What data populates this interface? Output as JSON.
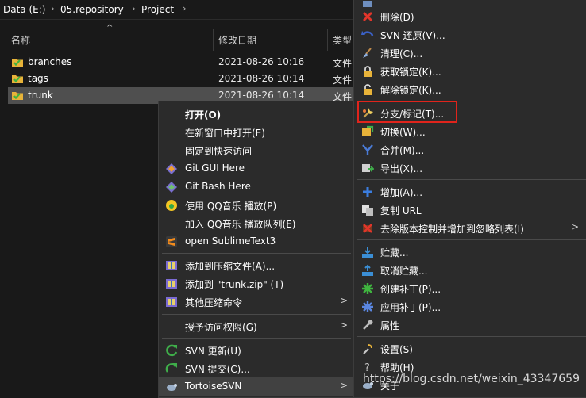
{
  "breadcrumb": {
    "items": [
      "Data (E:)",
      "05.repository",
      "Project"
    ],
    "separator": "›"
  },
  "columns": {
    "name": "名称",
    "date": "修改日期",
    "type": "类型"
  },
  "files": [
    {
      "name": "branches",
      "date": "2021-08-26 10:16",
      "type": "文件",
      "icon": "svn-folder-icon"
    },
    {
      "name": "tags",
      "date": "2021-08-26 10:14",
      "type": "文件",
      "icon": "svn-folder-icon"
    },
    {
      "name": "trunk",
      "date": "2021-08-26 10:14",
      "type": "文件",
      "icon": "svn-folder-icon",
      "selected": true
    }
  ],
  "context_menu": {
    "items": [
      {
        "label": "打开(O)",
        "bold": true
      },
      {
        "label": "在新窗口中打开(E)"
      },
      {
        "label": "固定到快速访问"
      },
      {
        "label": "Git GUI Here",
        "icon": "git-gui-icon"
      },
      {
        "label": "Git Bash Here",
        "icon": "git-bash-icon"
      },
      {
        "label": "使用 QQ音乐 播放(P)",
        "icon": "qq-music-icon"
      },
      {
        "label": "加入 QQ音乐 播放队列(E)"
      },
      {
        "label": "open SublimeText3",
        "icon": "sublime-icon"
      },
      {
        "label": "添加到压缩文件(A)...",
        "icon": "archive-icon"
      },
      {
        "label": "添加到 \"trunk.zip\" (T)",
        "icon": "archive-icon"
      },
      {
        "label": "其他压缩命令",
        "icon": "archive-icon",
        "submenu": true
      },
      {
        "label": "授予访问权限(G)",
        "submenu": true
      },
      {
        "label": "SVN 更新(U)",
        "icon": "svn-update-icon"
      },
      {
        "label": "SVN 提交(C)...",
        "icon": "svn-commit-icon"
      },
      {
        "label": "TortoiseSVN",
        "icon": "tortoisesvn-icon",
        "submenu": true,
        "highlighted": true
      }
    ]
  },
  "svn_menu": {
    "items": [
      {
        "label": "",
        "icon": "partial-icon"
      },
      {
        "label": "删除(D)",
        "icon": "delete-icon"
      },
      {
        "label": "SVN 还原(V)...",
        "icon": "revert-icon"
      },
      {
        "label": "清理(C)...",
        "icon": "cleanup-icon"
      },
      {
        "label": "获取锁定(K)...",
        "icon": "lock-icon"
      },
      {
        "label": "解除锁定(K)...",
        "icon": "unlock-icon"
      },
      {
        "label": "分支/标记(T)...",
        "icon": "branch-tag-icon"
      },
      {
        "label": "切换(W)...",
        "icon": "switch-icon"
      },
      {
        "label": "合并(M)...",
        "icon": "merge-icon"
      },
      {
        "label": "导出(X)...",
        "icon": "export-icon"
      },
      {
        "label": "增加(A)...",
        "icon": "add-icon"
      },
      {
        "label": "复制 URL",
        "icon": "copy-url-icon"
      },
      {
        "label": "去除版本控制并增加到忽略列表(I)",
        "icon": "ignore-icon",
        "submenu": true
      },
      {
        "label": "贮藏...",
        "icon": "shelve-icon"
      },
      {
        "label": "取消贮藏...",
        "icon": "unshelve-icon"
      },
      {
        "label": "创建补丁(P)...",
        "icon": "create-patch-icon"
      },
      {
        "label": "应用补丁(P)...",
        "icon": "apply-patch-icon"
      },
      {
        "label": "属性",
        "icon": "properties-icon"
      },
      {
        "label": "设置(S)",
        "icon": "settings-icon"
      },
      {
        "label": "帮助(H)",
        "icon": "help-icon"
      },
      {
        "label": "关于",
        "icon": "about-icon"
      }
    ]
  },
  "watermark": "https://blog.csdn.net/weixin_43347659",
  "colors": {
    "background": "#191919",
    "menu_bg": "#2b2b2b",
    "selected_row": "#4f4f4f",
    "highlight_box": "#e0241c",
    "svn_folder": "#e8b339",
    "svn_check": "#3fb43f"
  }
}
